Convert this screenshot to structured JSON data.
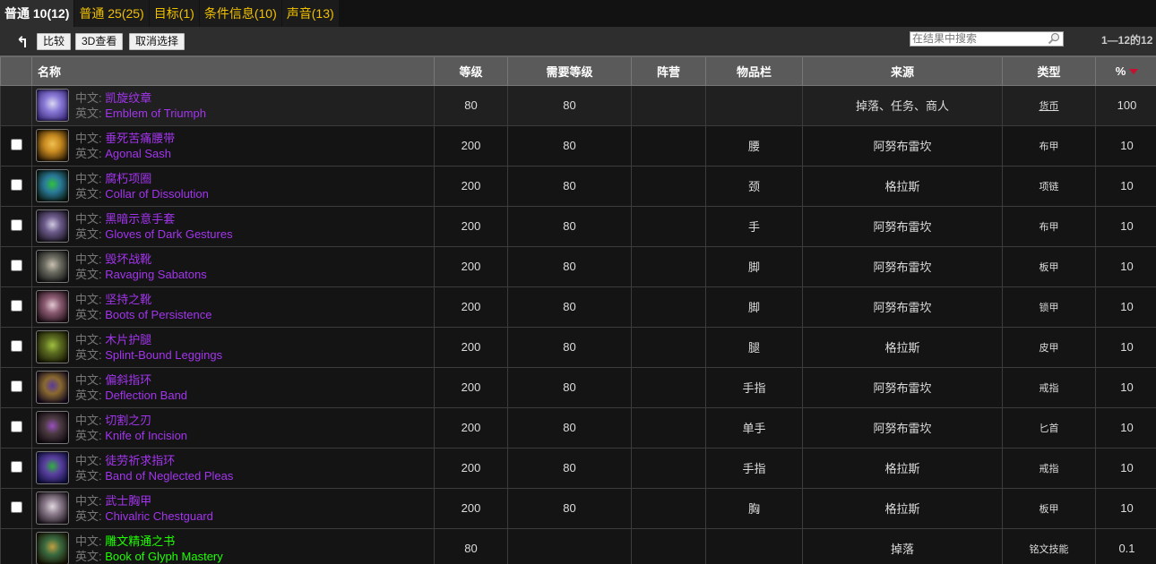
{
  "tabs": [
    {
      "label": "普通 10(12)",
      "active": true
    },
    {
      "label": "普通 25(25)"
    },
    {
      "label": "目标(1)"
    },
    {
      "label": "条件信息(10)"
    },
    {
      "label": "声音(13)"
    }
  ],
  "toolbar": {
    "back_icon": "↰",
    "compare_label": "比较",
    "view3d_label": "3D查看",
    "deselect_label": "取消选择",
    "search_placeholder": "在结果中搜索",
    "pager_text": "1—12的12"
  },
  "table": {
    "headers": {
      "name": "名称",
      "level": "等级",
      "req_level": "需要等级",
      "faction": "阵营",
      "slot": "物品栏",
      "source": "来源",
      "type": "类型",
      "percent": "%"
    },
    "cn_prefix": "中文:",
    "en_prefix": "英文:",
    "rows": [
      {
        "cn": "凯旋纹章",
        "en": "Emblem of Triumph",
        "level": "80",
        "req_level": "80",
        "faction": "",
        "slot": "",
        "source": "掉落、任务、商人",
        "type": "货币",
        "percent": "100",
        "quality": "epic",
        "checkbox": false,
        "icon": "emblem-icon",
        "icon_colors": [
          "#3b2a7a",
          "#8a7ad8",
          "#d8d8f0"
        ]
      },
      {
        "cn": "垂死苦痛腰带",
        "en": "Agonal Sash",
        "level": "200",
        "req_level": "80",
        "faction": "",
        "slot": "腰",
        "source": "阿努布雷坎",
        "type": "布甲",
        "percent": "10",
        "quality": "epic",
        "checkbox": true,
        "icon": "belt-icon",
        "icon_colors": [
          "#2a1a05",
          "#c88a20",
          "#f0c050"
        ]
      },
      {
        "cn": "腐朽项圈",
        "en": "Collar of Dissolution",
        "level": "200",
        "req_level": "80",
        "faction": "",
        "slot": "颈",
        "source": "格拉斯",
        "type": "项链",
        "percent": "10",
        "quality": "epic",
        "checkbox": true,
        "icon": "necklace-icon",
        "icon_colors": [
          "#0a1a10",
          "#2a7a9a",
          "#30c040"
        ]
      },
      {
        "cn": "黑暗示意手套",
        "en": "Gloves of Dark Gestures",
        "level": "200",
        "req_level": "80",
        "faction": "",
        "slot": "手",
        "source": "阿努布雷坎",
        "type": "布甲",
        "percent": "10",
        "quality": "epic",
        "checkbox": true,
        "icon": "gloves-icon",
        "icon_colors": [
          "#1a1520",
          "#6a5a8a",
          "#d0c8e0"
        ]
      },
      {
        "cn": "毁坏战靴",
        "en": "Ravaging Sabatons",
        "level": "200",
        "req_level": "80",
        "faction": "",
        "slot": "脚",
        "source": "阿努布雷坎",
        "type": "板甲",
        "percent": "10",
        "quality": "epic",
        "checkbox": true,
        "icon": "boots-plate-icon",
        "icon_colors": [
          "#151515",
          "#6a6a60",
          "#c8c0b0"
        ]
      },
      {
        "cn": "坚持之靴",
        "en": "Boots of Persistence",
        "level": "200",
        "req_level": "80",
        "faction": "",
        "slot": "脚",
        "source": "阿努布雷坎",
        "type": "锁甲",
        "percent": "10",
        "quality": "epic",
        "checkbox": true,
        "icon": "boots-mail-icon",
        "icon_colors": [
          "#201018",
          "#8a5a70",
          "#e0c8d0"
        ]
      },
      {
        "cn": "木片护腿",
        "en": "Splint-Bound Leggings",
        "level": "200",
        "req_level": "80",
        "faction": "",
        "slot": "腿",
        "source": "格拉斯",
        "type": "皮甲",
        "percent": "10",
        "quality": "epic",
        "checkbox": true,
        "icon": "leggings-icon",
        "icon_colors": [
          "#1a1a05",
          "#5a6a20",
          "#a0c040"
        ]
      },
      {
        "cn": "偏斜指环",
        "en": "Deflection Band",
        "level": "200",
        "req_level": "80",
        "faction": "",
        "slot": "手指",
        "source": "阿努布雷坎",
        "type": "戒指",
        "percent": "10",
        "quality": "epic",
        "checkbox": true,
        "icon": "ring-icon",
        "icon_colors": [
          "#150a20",
          "#8a6a30",
          "#5a3a9a"
        ]
      },
      {
        "cn": "切割之刃",
        "en": "Knife of Incision",
        "level": "200",
        "req_level": "80",
        "faction": "",
        "slot": "单手",
        "source": "阿努布雷坎",
        "type": "匕首",
        "percent": "10",
        "quality": "epic",
        "checkbox": true,
        "icon": "dagger-icon",
        "icon_colors": [
          "#100a10",
          "#4a3a40",
          "#9a50c0"
        ]
      },
      {
        "cn": "徒劳祈求指环",
        "en": "Band of Neglected Pleas",
        "level": "200",
        "req_level": "80",
        "faction": "",
        "slot": "手指",
        "source": "格拉斯",
        "type": "戒指",
        "percent": "10",
        "quality": "epic",
        "checkbox": true,
        "icon": "ring-gem-icon",
        "icon_colors": [
          "#101040",
          "#5a40a0",
          "#30b040"
        ]
      },
      {
        "cn": "武士胸甲",
        "en": "Chivalric Chestguard",
        "level": "200",
        "req_level": "80",
        "faction": "",
        "slot": "胸",
        "source": "格拉斯",
        "type": "板甲",
        "percent": "10",
        "quality": "epic",
        "checkbox": true,
        "icon": "chest-icon",
        "icon_colors": [
          "#201820",
          "#8a7a8a",
          "#e0d8e0"
        ]
      },
      {
        "cn": "雕文精通之书",
        "en": "Book of Glyph Mastery",
        "level": "80",
        "req_level": "",
        "faction": "",
        "slot": "",
        "source": "掉落",
        "type": "铭文技能",
        "percent": "0.1",
        "quality": "uncommon",
        "checkbox": false,
        "icon": "book-icon",
        "icon_colors": [
          "#1a1505",
          "#3a6a40",
          "#c0a040"
        ]
      }
    ]
  },
  "colors": {
    "tab_text": "#f0c000",
    "epic": "#a335ee",
    "uncommon": "#1eff00",
    "sort_arrow": "#c8102e"
  }
}
